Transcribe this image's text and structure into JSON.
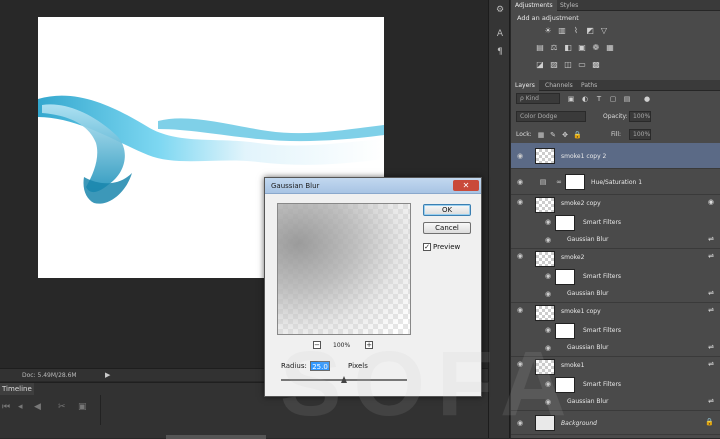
{
  "statusbar": {
    "doc_info": "Doc: 5.49M/28.6M",
    "arrow": "▶"
  },
  "timeline": {
    "tab_label": "Timeline"
  },
  "adjustments_panel": {
    "tabs": [
      "Adjustments",
      "Styles"
    ],
    "title": "Add an adjustment"
  },
  "layers_panel": {
    "tabs": [
      "Layers",
      "Channels",
      "Paths"
    ],
    "filter_kind": "ρ Kind",
    "blend_mode": "Color Dodge",
    "opacity_label": "Opacity:",
    "opacity_value": "100%",
    "lock_label": "Lock:",
    "fill_label": "Fill:",
    "fill_value": "100%",
    "layers": [
      {
        "name": "smoke1 copy 2",
        "selected": true
      },
      {
        "name": "Hue/Saturation 1"
      },
      {
        "name": "smoke2 copy"
      },
      {
        "name": "Smart Filters"
      },
      {
        "name": "Gaussian Blur"
      },
      {
        "name": "smoke2"
      },
      {
        "name": "Smart Filters"
      },
      {
        "name": "Gaussian Blur"
      },
      {
        "name": "smoke1 copy"
      },
      {
        "name": "Smart Filters"
      },
      {
        "name": "Gaussian Blur"
      },
      {
        "name": "smoke1"
      },
      {
        "name": "Smart Filters"
      },
      {
        "name": "Gaussian Blur"
      },
      {
        "name": "Background"
      }
    ]
  },
  "dialog": {
    "title": "Gaussian Blur",
    "close": "✕",
    "ok_label": "OK",
    "cancel_label": "Cancel",
    "preview_label": "Preview",
    "preview_checked": "✓",
    "zoom_level": "100%",
    "zoom_out": "−",
    "zoom_in": "+",
    "radius_label": "Radius:",
    "radius_value": "25.0",
    "radius_unit": "Pixels",
    "radius_slider_position": 0.5
  },
  "watermark": "SOFA",
  "colors": {
    "selection": "#5b6a86",
    "dialog_bg": "#f0f0f0",
    "smoke_blue": "#2ab0d8"
  }
}
